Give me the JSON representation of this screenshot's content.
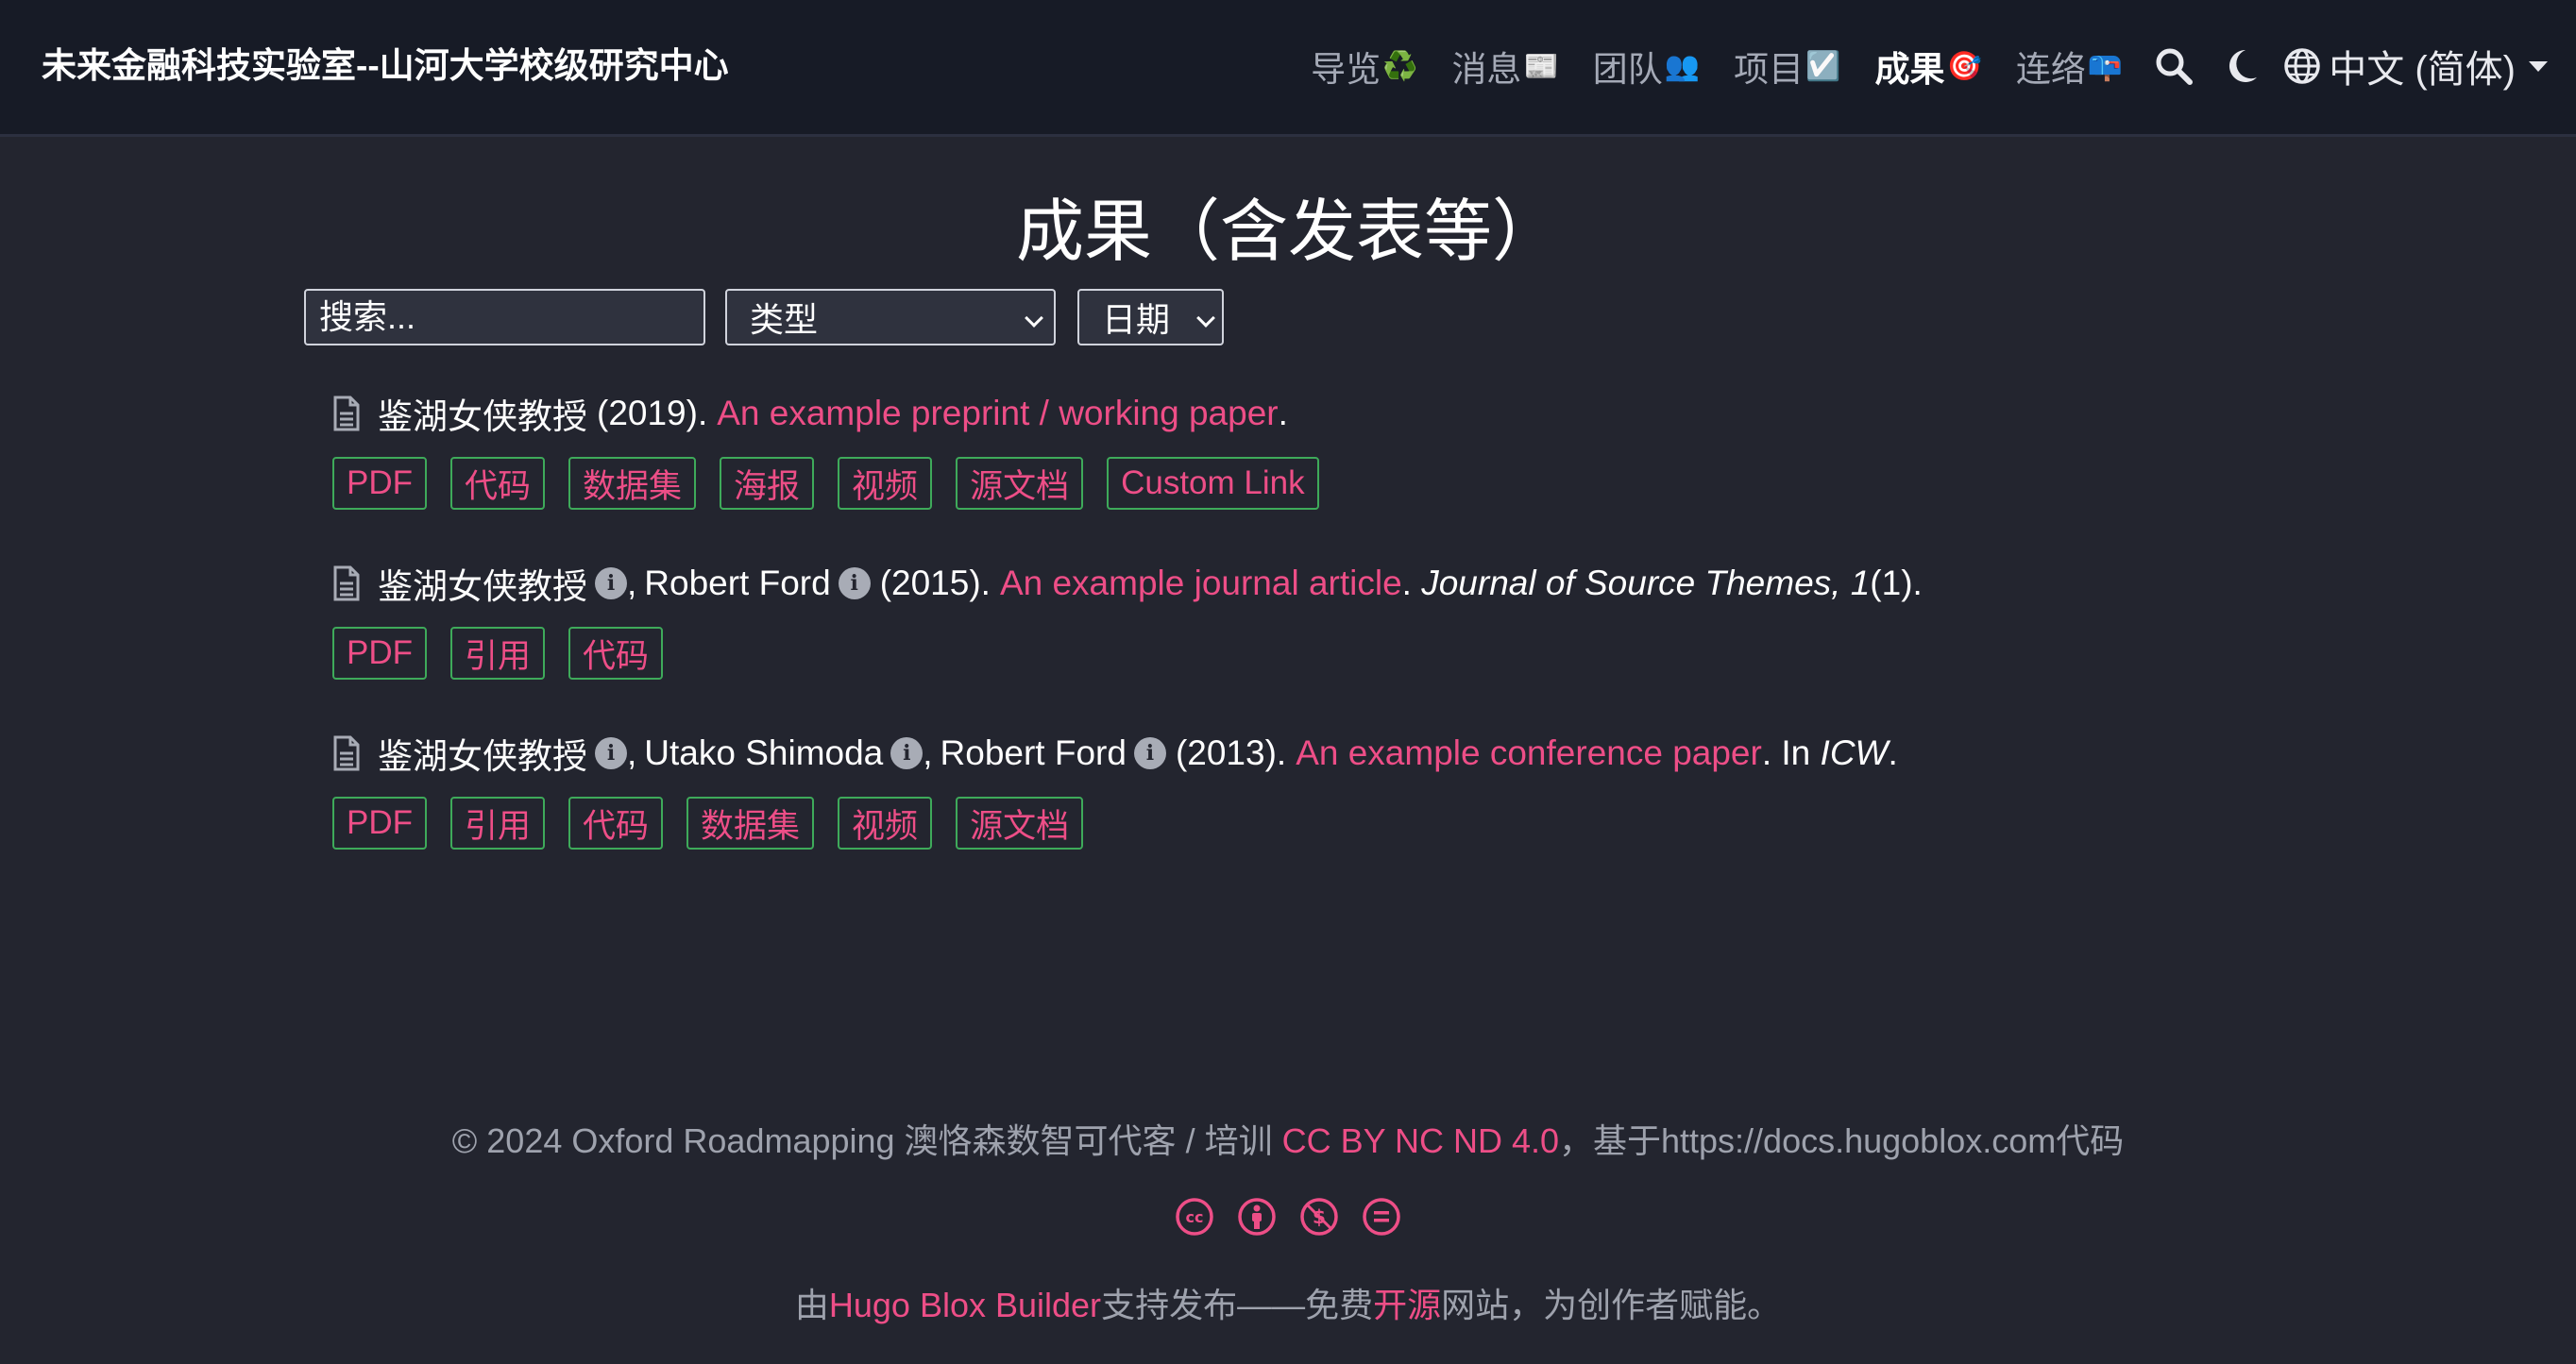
{
  "navbar": {
    "brand": "未来金融科技实验室--山河大学校级研究中心",
    "items": [
      {
        "label": "导览",
        "emoji": "♻️",
        "active": false
      },
      {
        "label": "消息",
        "emoji": "📰",
        "active": false
      },
      {
        "label": "团队",
        "emoji": "👥",
        "active": false
      },
      {
        "label": "项目",
        "emoji": "☑️",
        "active": false
      },
      {
        "label": "成果",
        "emoji": "🎯",
        "active": true
      },
      {
        "label": "连络",
        "emoji": "📪",
        "active": false
      }
    ],
    "search_icon": "search-icon",
    "theme_icon": "moon-icon",
    "language": "中文 (简体)"
  },
  "page": {
    "title": "成果（含发表等）"
  },
  "filters": {
    "search_placeholder": "搜索...",
    "type_label": "类型",
    "date_label": "日期"
  },
  "publications": [
    {
      "authors": [
        "鉴湖女侠教授"
      ],
      "year": "(2019).",
      "title": "An example preprint / working paper",
      "buttons": [
        "PDF",
        "代码",
        "数据集",
        "海报",
        "视频",
        "源文档",
        "Custom Link"
      ]
    },
    {
      "authors": [
        "鉴湖女侠教授",
        "Robert Ford"
      ],
      "year": "(2015).",
      "title": "An example journal article",
      "venue_italic": "Journal of Source Themes, 1",
      "venue_rest": "(1).",
      "buttons": [
        "PDF",
        "引用",
        "代码"
      ]
    },
    {
      "authors": [
        "鉴湖女侠教授",
        "Utako Shimoda",
        "Robert Ford"
      ],
      "year": "(2013).",
      "title": "An example conference paper",
      "venue_prefix": ". In ",
      "venue_italic": "ICW",
      "venue_rest": ".",
      "buttons": [
        "PDF",
        "引用",
        "代码",
        "数据集",
        "视频",
        "源文档"
      ]
    }
  ],
  "footer": {
    "copyright_prefix": "© 2024 Oxford Roadmapping 澳恪森数智可代客 / 培训 ",
    "license_link": "CC BY NC ND 4.0",
    "copyright_suffix": "，基于https://docs.hugoblox.com代码",
    "cc_icons": [
      "cc-icon",
      "by-icon",
      "nc-icon",
      "nd-icon"
    ],
    "powered_prefix": "由",
    "powered_link": "Hugo Blox Builder",
    "powered_middle": "支持发布——免费",
    "open_source_link": "开源",
    "powered_suffix": "网站，为创作者赋能。"
  },
  "colors": {
    "background": "#23252f",
    "navbar": "#171b26",
    "link": "#ed4e87",
    "button_border": "#3eaa5a",
    "muted_text": "#9ea2ad"
  }
}
